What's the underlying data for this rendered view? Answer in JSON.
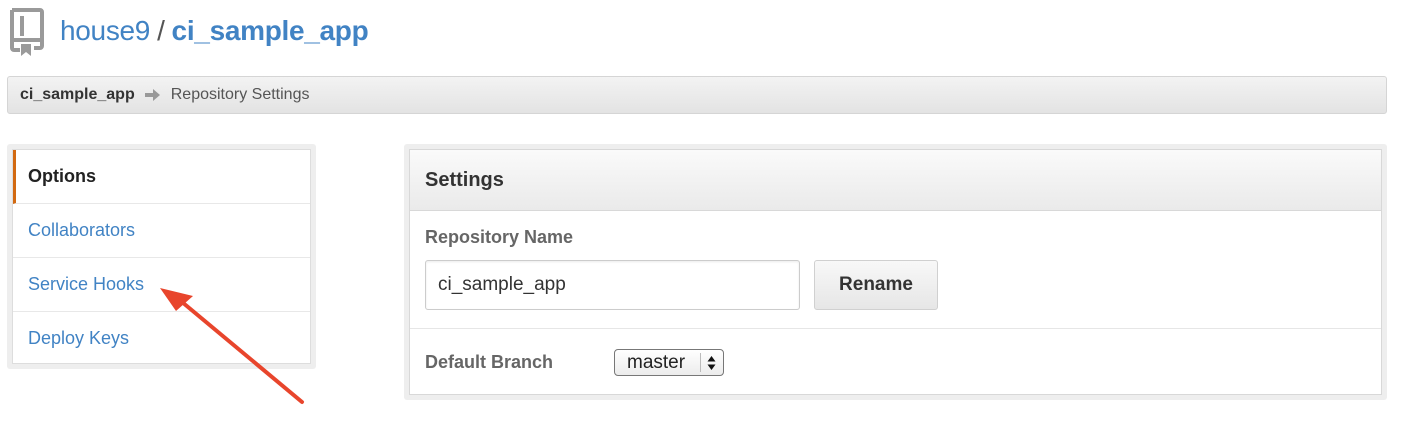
{
  "header": {
    "owner": "house9",
    "separator": "/",
    "repo_name": "ci_sample_app",
    "icon": "repo-book-icon"
  },
  "breadcrumb": {
    "repo": "ci_sample_app",
    "arrow_icon": "arrow-right-icon",
    "current": "Repository Settings"
  },
  "sidebar": {
    "items": [
      {
        "label": "Options",
        "selected": true
      },
      {
        "label": "Collaborators",
        "selected": false
      },
      {
        "label": "Service Hooks",
        "selected": false
      },
      {
        "label": "Deploy Keys",
        "selected": false
      }
    ]
  },
  "settings": {
    "title": "Settings",
    "repo_name_label": "Repository Name",
    "repo_name_value": "ci_sample_app",
    "rename_button": "Rename",
    "default_branch_label": "Default Branch",
    "default_branch_value": "master"
  },
  "colors": {
    "link": "#4183c4",
    "selected_marker": "#d26911",
    "annotation_arrow": "#e8452c"
  }
}
